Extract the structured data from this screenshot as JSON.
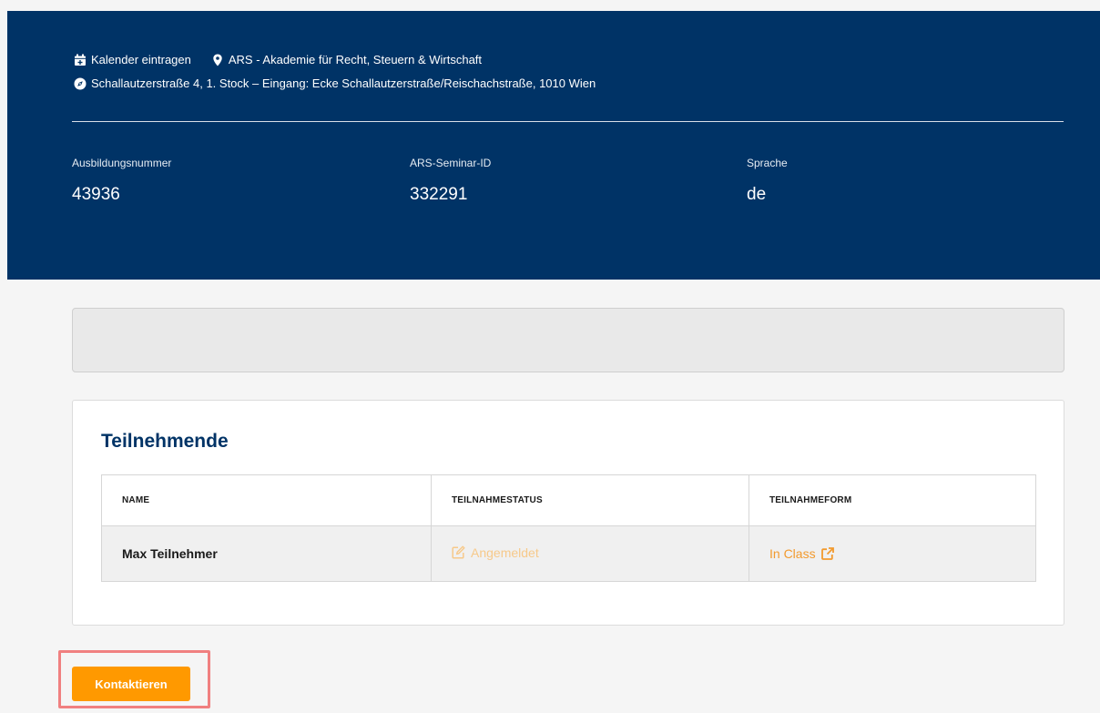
{
  "event_meta": {
    "calendar_label": "Kalender eintragen",
    "venue": "ARS - Akademie für Recht, Steuern & Wirtschaft",
    "address": "Schallautzerstraße 4, 1. Stock – Eingang: Ecke Schallautzerstraße/Reischachstraße, 1010 Wien"
  },
  "stats": [
    {
      "label": "Ausbildungsnummer",
      "value": "43936"
    },
    {
      "label": "ARS-Seminar-ID",
      "value": "332291"
    },
    {
      "label": "Sprache",
      "value": "de"
    }
  ],
  "participants": {
    "title": "Teilnehmende",
    "columns": [
      "NAME",
      "TEILNAHMESTATUS",
      "TEILNAHMEFORM"
    ],
    "rows": [
      {
        "name": "Max Teilnehmer",
        "status": "Angemeldet",
        "form": "In Class"
      }
    ]
  },
  "actions": {
    "contact_label": "Kontaktieren"
  },
  "colors": {
    "header_bg": "#003366",
    "accent_orange": "#ff9900",
    "status_text": "#f7c98a",
    "form_link": "#f29a2e"
  },
  "icons": [
    "calendar-plus-icon",
    "map-marker-icon",
    "compass-icon",
    "edit-icon",
    "external-link-icon"
  ]
}
